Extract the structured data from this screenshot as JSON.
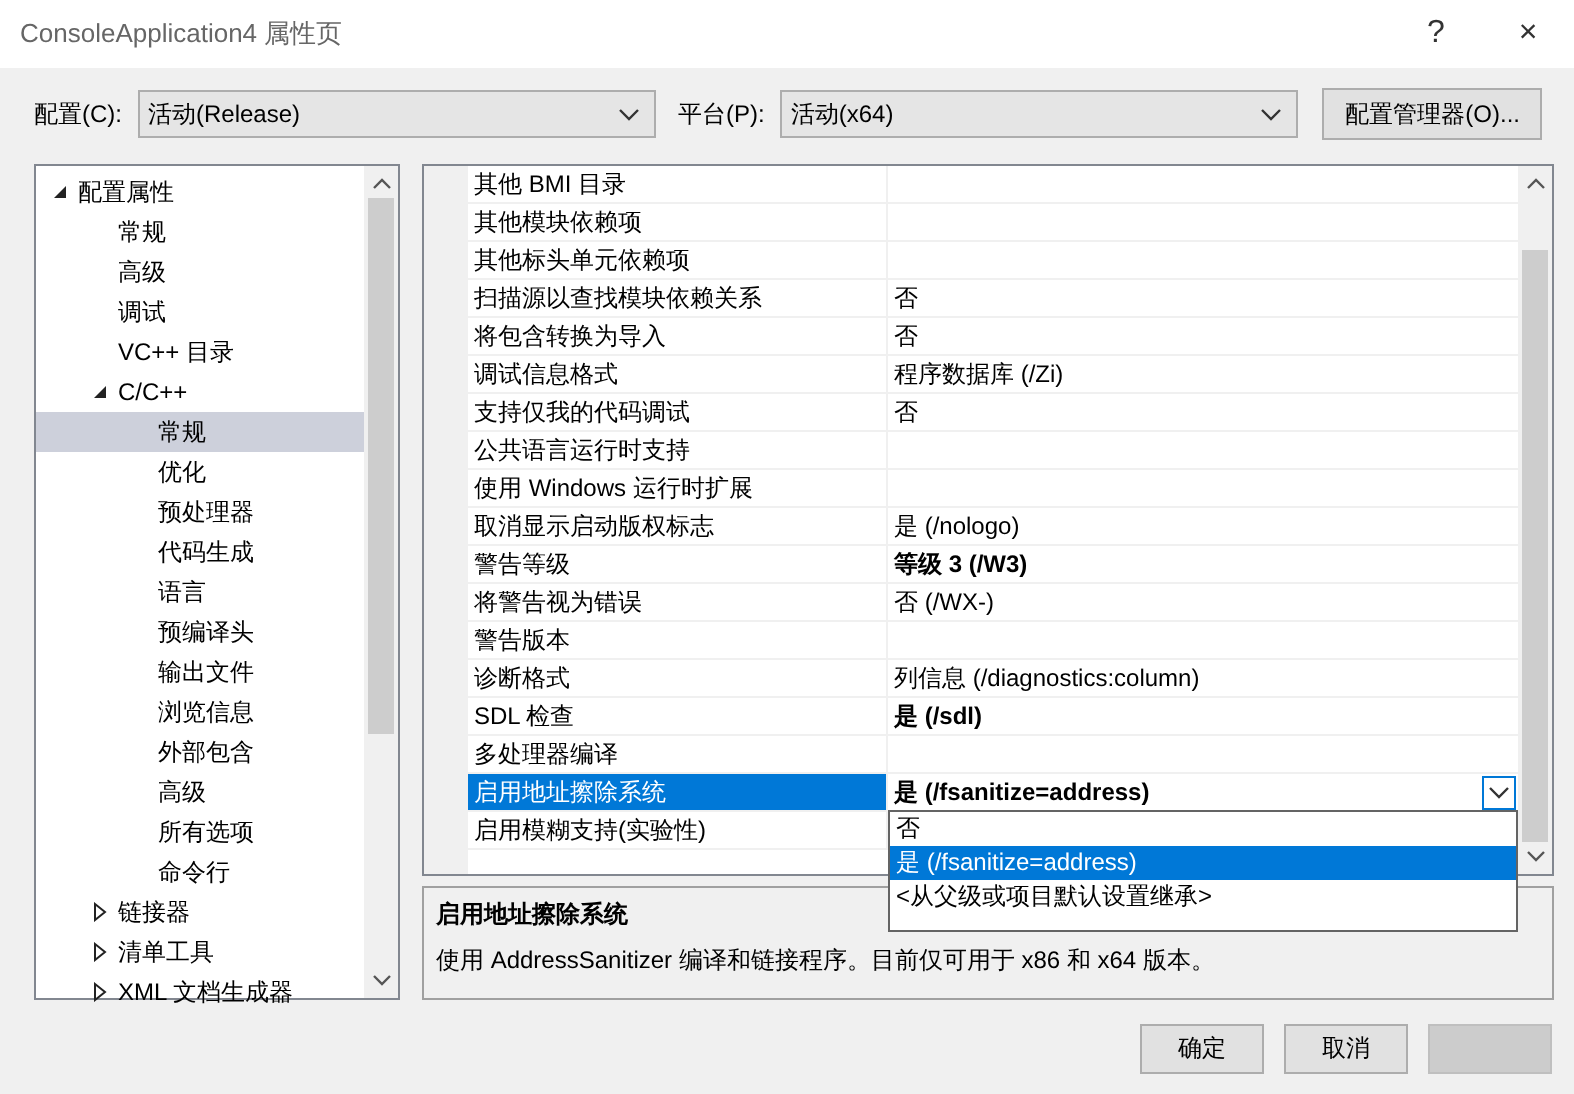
{
  "window": {
    "title": "ConsoleApplication4 属性页",
    "help": "?",
    "close": "×"
  },
  "config_bar": {
    "config_label": "配置(C):",
    "config_value": "活动(Release)",
    "platform_label": "平台(P):",
    "platform_value": "活动(x64)",
    "manager_button": "配置管理器(O)..."
  },
  "tree": [
    {
      "label": "配置属性",
      "expanded": true,
      "selected": false,
      "children": [
        {
          "label": "常规",
          "selected": false
        },
        {
          "label": "高级",
          "selected": false
        },
        {
          "label": "调试",
          "selected": false
        },
        {
          "label": "VC++ 目录",
          "selected": false
        },
        {
          "label": "C/C++",
          "expanded": true,
          "selected": false,
          "children": [
            {
              "label": "常规",
              "selected": true
            },
            {
              "label": "优化",
              "selected": false
            },
            {
              "label": "预处理器",
              "selected": false
            },
            {
              "label": "代码生成",
              "selected": false
            },
            {
              "label": "语言",
              "selected": false
            },
            {
              "label": "预编译头",
              "selected": false
            },
            {
              "label": "输出文件",
              "selected": false
            },
            {
              "label": "浏览信息",
              "selected": false
            },
            {
              "label": "外部包含",
              "selected": false
            },
            {
              "label": "高级",
              "selected": false
            },
            {
              "label": "所有选项",
              "selected": false
            },
            {
              "label": "命令行",
              "selected": false
            }
          ]
        },
        {
          "label": "链接器",
          "expanded": false,
          "selected": false
        },
        {
          "label": "清单工具",
          "expanded": false,
          "selected": false
        },
        {
          "label": "XML 文档生成器",
          "expanded": false,
          "selected": false
        }
      ]
    }
  ],
  "properties": [
    {
      "name": "其他 BMI 目录",
      "selected": false
    },
    {
      "name": "其他模块依赖项",
      "selected": false
    },
    {
      "name": "其他标头单元依赖项",
      "selected": false
    },
    {
      "name": "扫描源以查找模块依赖关系",
      "value": "否",
      "bold": false,
      "selected": false
    },
    {
      "name": "将包含转换为导入",
      "value": "否",
      "bold": false,
      "selected": false
    },
    {
      "name": "调试信息格式",
      "value": "程序数据库 (/Zi)",
      "bold": false,
      "selected": false
    },
    {
      "name": "支持仅我的代码调试",
      "value": "否",
      "bold": false,
      "selected": false
    },
    {
      "name": "公共语言运行时支持",
      "selected": false
    },
    {
      "name": "使用 Windows 运行时扩展",
      "selected": false
    },
    {
      "name": "取消显示启动版权标志",
      "value": "是 (/nologo)",
      "bold": false,
      "selected": false
    },
    {
      "name": "警告等级",
      "value": "等级 3 (/W3)",
      "bold": true,
      "selected": false
    },
    {
      "name": "将警告视为错误",
      "value": "否 (/WX-)",
      "bold": false,
      "selected": false
    },
    {
      "name": "警告版本",
      "selected": false
    },
    {
      "name": "诊断格式",
      "value": "列信息 (/diagnostics:column)",
      "bold": false,
      "selected": false
    },
    {
      "name": "SDL 检查",
      "value": "是 (/sdl)",
      "bold": true,
      "selected": false
    },
    {
      "name": "多处理器编译",
      "selected": false
    },
    {
      "name": "启用地址擦除系统",
      "value": "是 (/fsanitize=address)",
      "bold": true,
      "selected": true
    },
    {
      "name": "启用模糊支持(实验性)",
      "selected": false
    }
  ],
  "dropdown_options": [
    {
      "label": "否",
      "selected": false
    },
    {
      "label": "是 (/fsanitize=address)",
      "selected": true
    },
    {
      "label": "<从父级或项目默认设置继承>",
      "selected": false
    }
  ],
  "description": {
    "title": "启用地址擦除系统",
    "text": "使用 AddressSanitizer 编译和链接程序。目前仅可用于 x86 和 x64 版本。"
  },
  "buttons": [
    {
      "label": "确定",
      "disabled": false
    },
    {
      "label": "取消",
      "disabled": false
    },
    {
      "disabled": true
    }
  ]
}
